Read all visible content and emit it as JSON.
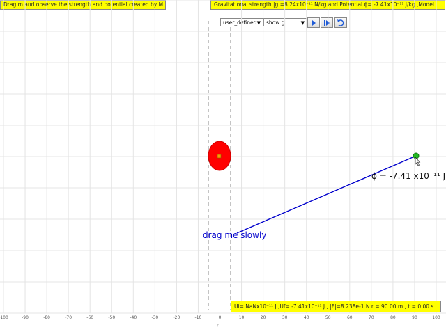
{
  "banners": {
    "left": "Drag m and observe the strength and potential created by M",
    "right": "Gravitational strength |g|=8.24x10⁻¹¹ N/kg and Potential ϕ= -7.41x10⁻¹¹ J/kg ,Model",
    "bottom": "Ui= NaNx10⁻¹¹ J ,Uf= -7.41x10⁻¹¹ J , |F|=8.238e-1 N r = 90.00 m , t = 0.00 s"
  },
  "controls": {
    "mode_select": "user_defined",
    "view_select": "show g",
    "caret": "▼",
    "play_icon": "play-icon",
    "step_icon": "step-forward-icon",
    "reset_icon": "reset-icon"
  },
  "plot": {
    "x_ticks": [
      "-100",
      "-90",
      "-80",
      "-70",
      "-60",
      "-50",
      "-40",
      "-30",
      "-20",
      "-10",
      "0",
      "10",
      "20",
      "30",
      "40",
      "50",
      "60",
      "70",
      "80",
      "90",
      "100"
    ],
    "x_axis_label": "r",
    "phi_label": "ϕ = -7.41 x10⁻¹¹ J",
    "drag_label": "drag me slowly",
    "colors": {
      "mass_M": "#ff0000",
      "mass_m": "#22bb22",
      "line": "#0000cc",
      "banner": "#ffff00"
    }
  }
}
